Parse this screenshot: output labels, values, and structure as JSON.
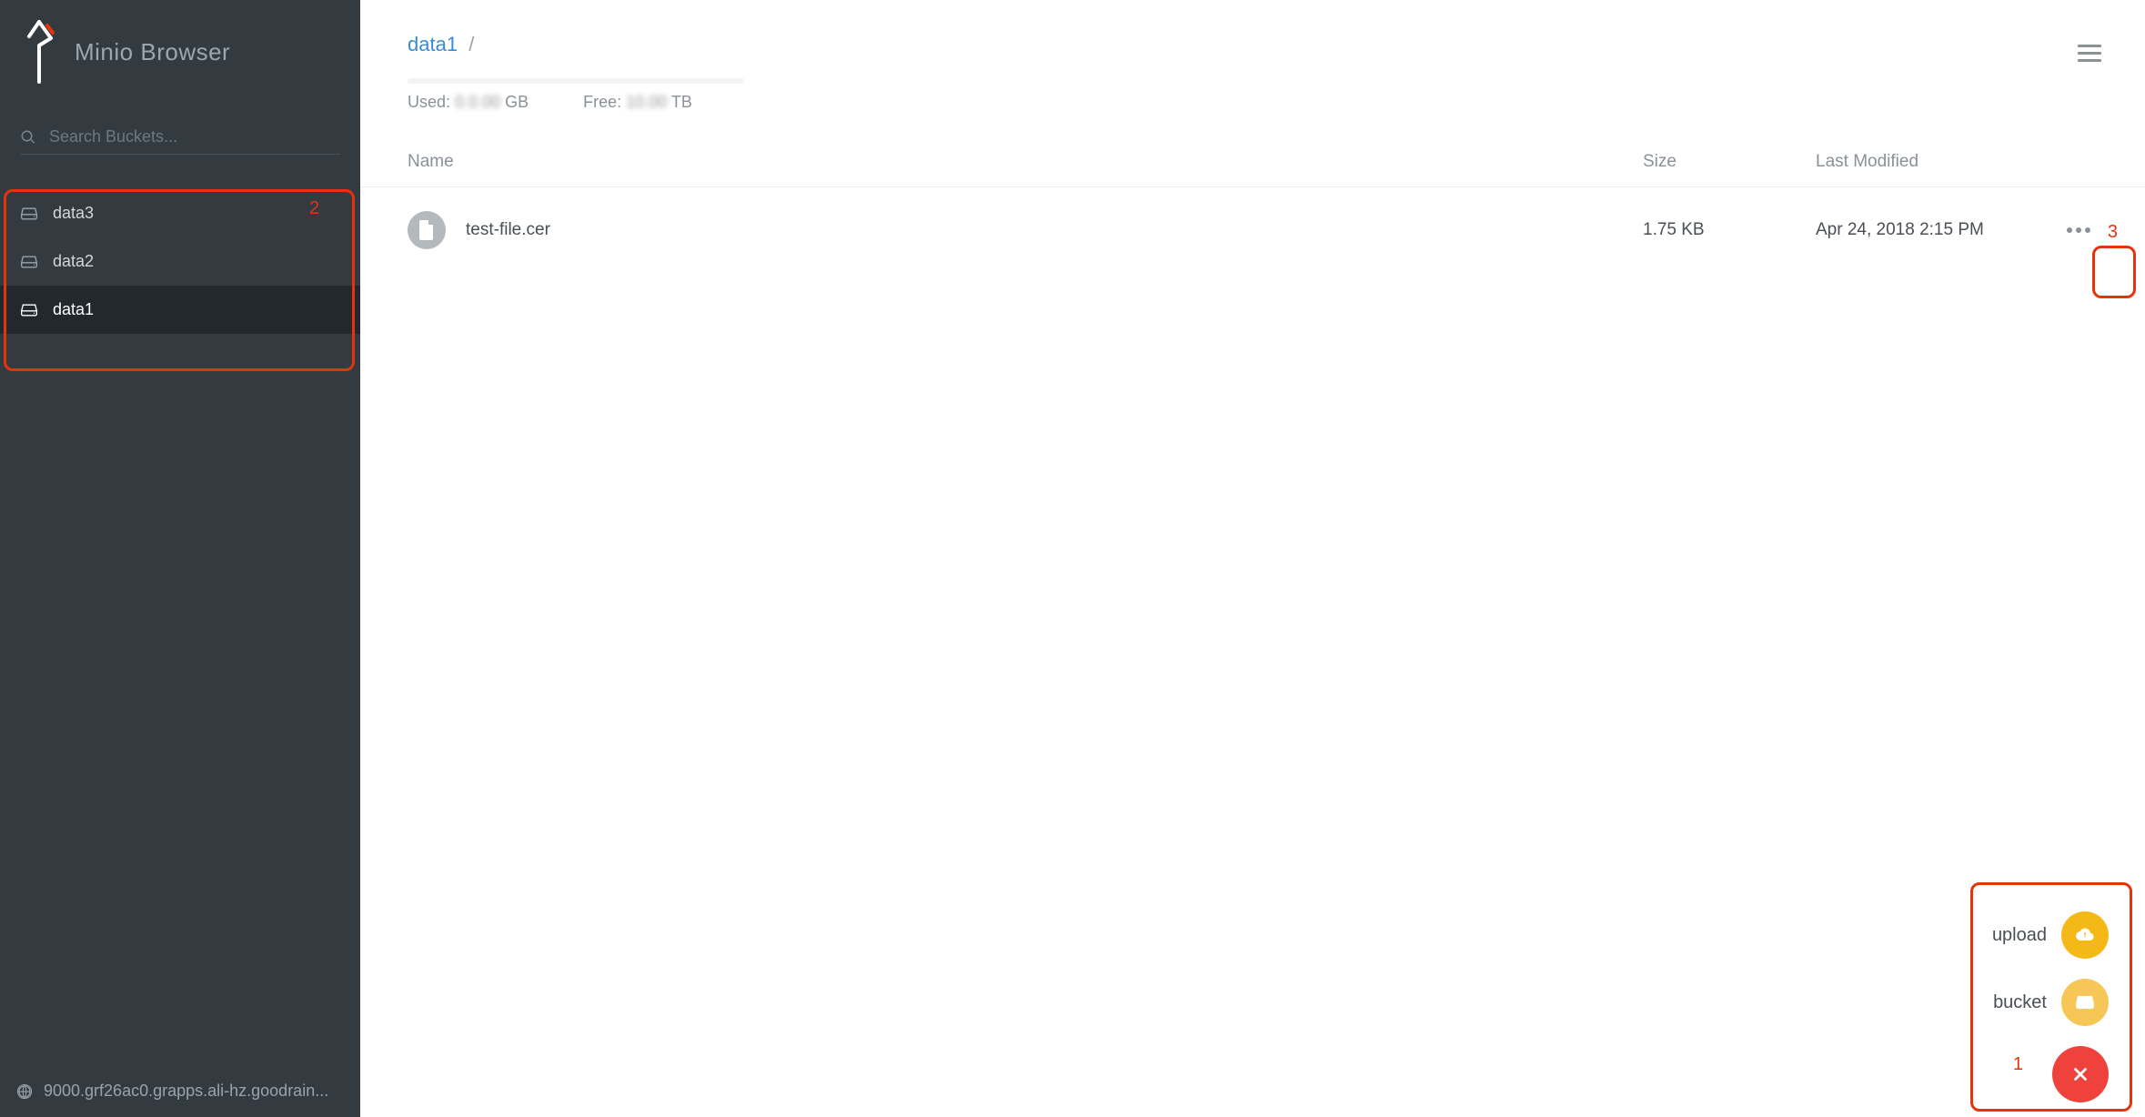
{
  "brand": {
    "title": "Minio Browser"
  },
  "search": {
    "placeholder": "Search Buckets..."
  },
  "buckets": [
    {
      "name": "data3",
      "active": false
    },
    {
      "name": "data2",
      "active": false
    },
    {
      "name": "data1",
      "active": true
    }
  ],
  "host": "9000.grf26ac0.grapps.ali-hz.goodrain...",
  "breadcrumb": {
    "bucket": "data1",
    "sep": "/"
  },
  "storage": {
    "used_label": "Used:",
    "used_value": "GB",
    "free_label": "Free:",
    "free_value": "TB"
  },
  "columns": {
    "name": "Name",
    "size": "Size",
    "modified": "Last Modified"
  },
  "files": [
    {
      "name": "test-file.cer",
      "size": "1.75 KB",
      "modified": "Apr 24, 2018 2:15 PM"
    }
  ],
  "fab": {
    "upload": "upload",
    "bucket": "bucket"
  },
  "annotations": {
    "a1": "1",
    "a2": "2",
    "a3": "3"
  }
}
